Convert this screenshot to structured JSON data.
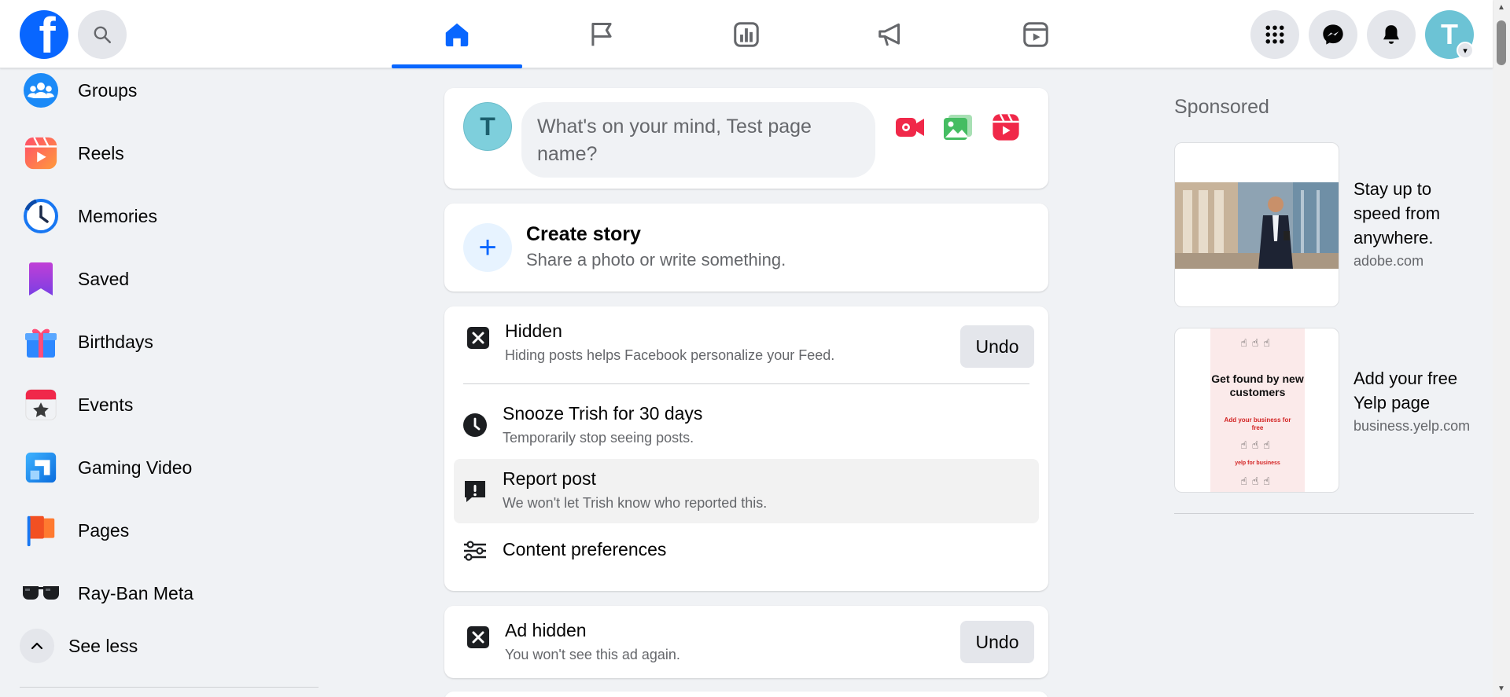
{
  "topbar": {
    "logo_letter": "f",
    "nav_tabs": [
      {
        "name": "home-icon",
        "active": true
      },
      {
        "name": "flag-icon",
        "active": false
      },
      {
        "name": "insights-icon",
        "active": false
      },
      {
        "name": "megaphone-icon",
        "active": false
      },
      {
        "name": "video-icon",
        "active": false
      }
    ],
    "avatar_letter": "T"
  },
  "sidebar": {
    "items": [
      {
        "label": "Groups",
        "icon": "groups-icon"
      },
      {
        "label": "Reels",
        "icon": "reels-icon"
      },
      {
        "label": "Memories",
        "icon": "memories-icon"
      },
      {
        "label": "Saved",
        "icon": "saved-icon"
      },
      {
        "label": "Birthdays",
        "icon": "birthdays-icon"
      },
      {
        "label": "Events",
        "icon": "events-icon"
      },
      {
        "label": "Gaming Video",
        "icon": "gaming-video-icon"
      },
      {
        "label": "Pages",
        "icon": "pages-icon"
      },
      {
        "label": "Ray-Ban Meta",
        "icon": "ray-ban-meta-icon"
      }
    ],
    "see_less": "See less"
  },
  "composer": {
    "avatar_letter": "T",
    "placeholder": "What's on your mind, Test page name?"
  },
  "story": {
    "title": "Create story",
    "subtitle": "Share a photo or write something."
  },
  "hidden_post": {
    "title": "Hidden",
    "subtitle": "Hiding posts helps Facebook personalize your Feed.",
    "undo": "Undo",
    "menu": [
      {
        "title": "Snooze Trish for 30 days",
        "subtitle": "Temporarily stop seeing posts."
      },
      {
        "title": "Report post",
        "subtitle": "We won't let Trish know who reported this."
      },
      {
        "title": "Content preferences",
        "subtitle": ""
      }
    ]
  },
  "ad_hidden": {
    "title": "Ad hidden",
    "subtitle": "You won't see this ad again.",
    "undo": "Undo"
  },
  "sponsored": {
    "title": "Sponsored",
    "ads": [
      {
        "title": "Stay up to speed from anywhere.",
        "domain": "adobe.com"
      },
      {
        "title": "Add your free Yelp page",
        "domain": "business.yelp.com",
        "image_text_1": "Get found by new customers",
        "image_text_2": "Add your business for free",
        "image_brand": "yelp for business"
      }
    ]
  },
  "colors": {
    "brand_blue": "#0866ff",
    "page_bg": "#f0f2f5",
    "avatar_teal": "#7ecfdc"
  }
}
